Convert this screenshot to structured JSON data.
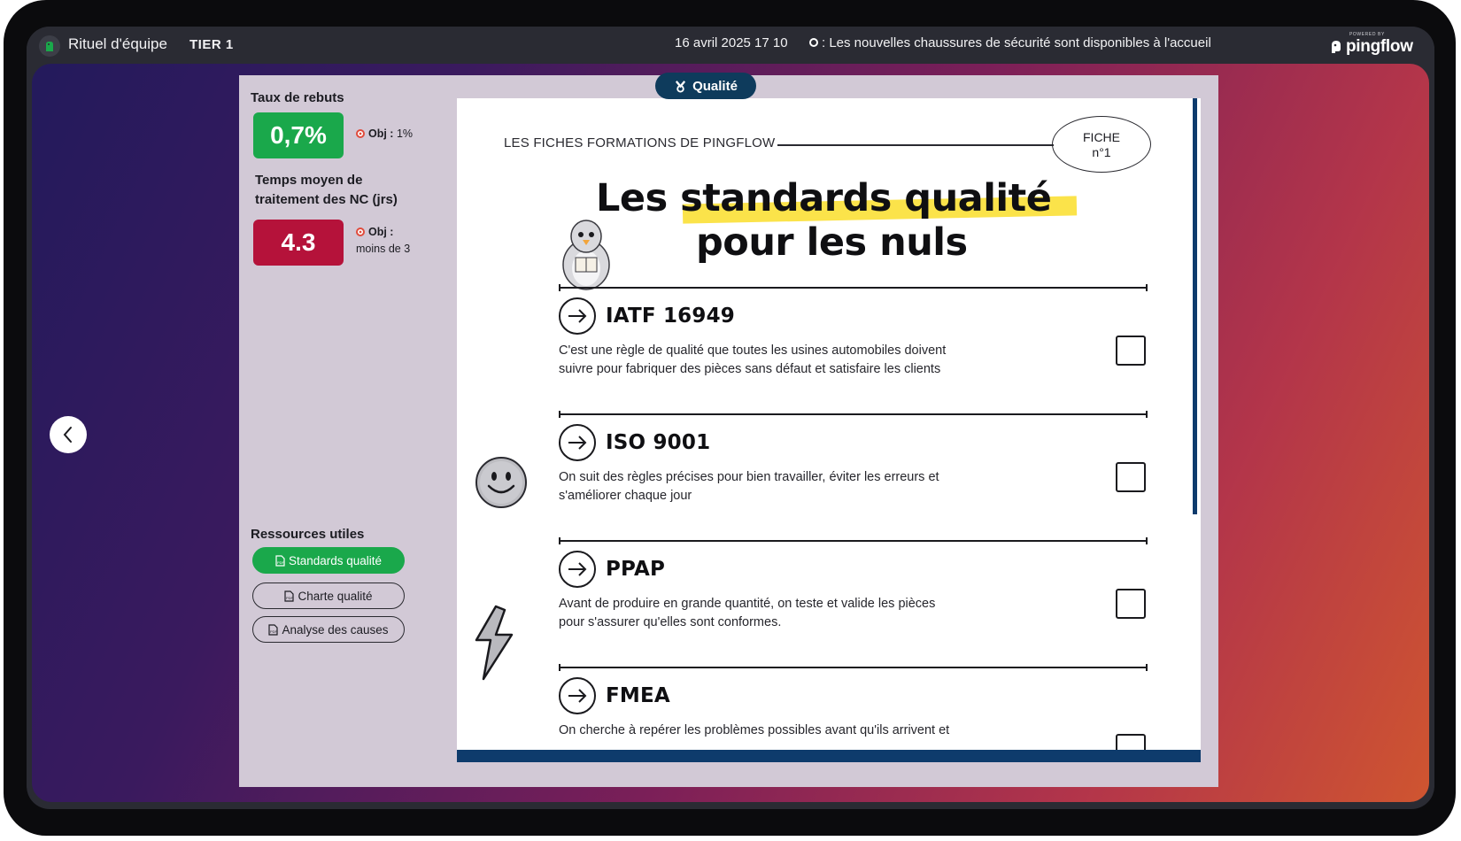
{
  "header": {
    "app_title": "Rituel d'équipe",
    "tier": "TIER 1",
    "datetime": "16 avril 2025 17 10",
    "ticker": ": Les nouvelles chaussures de sécurité sont disponibles à l'accueil",
    "brand_powered": "POWERED BY",
    "brand_name": "pingflow"
  },
  "card": {
    "tab_label": "Qualité",
    "kpis": [
      {
        "label": "Taux de rebuts",
        "value": "0,7%",
        "value_color": "#1aa84b",
        "obj_label": "Obj :",
        "obj_value": "1%"
      },
      {
        "label_line1": "Temps moyen de",
        "label_line2": "traitement des NC (jrs)",
        "value": "4.3",
        "value_color": "#b5123a",
        "obj_label": "Obj :",
        "obj_value": "moins de 3"
      }
    ],
    "resources": {
      "title": "Ressources utiles",
      "items": [
        {
          "label": "Standards qualité",
          "active": true
        },
        {
          "label": "Charte qualité",
          "active": false
        },
        {
          "label": "Analyse des causes",
          "active": false
        }
      ]
    }
  },
  "document": {
    "series_label": "LES FICHES FORMATIONS DE PINGFLOW",
    "fiche_line1": "FICHE",
    "fiche_line2": "n°1",
    "title_part1": "Les",
    "title_highlight": "standards qualité",
    "title_line2": "pour les nuls",
    "standards": [
      {
        "name": "IATF 16949",
        "desc_line1": "C'est une règle de qualité que toutes les usines automobiles doivent",
        "desc_line2": "suivre pour fabriquer des pièces sans défaut et satisfaire les clients",
        "checked": false
      },
      {
        "name": "ISO 9001",
        "desc_line1": "On suit des règles précises pour bien travailler, éviter les erreurs et",
        "desc_line2": "s'améliorer chaque jour",
        "checked": false
      },
      {
        "name": "PPAP",
        "desc_line1": "Avant de produire en grande quantité, on teste et valide les pièces",
        "desc_line2": "pour s'assurer qu'elles sont conformes.",
        "checked": false
      },
      {
        "name": "FMEA",
        "desc_line1": "On cherche à repérer les problèmes possibles avant qu'ils arrivent et",
        "desc_line2": "",
        "checked": false
      }
    ]
  },
  "colors": {
    "accent_green": "#1aa84b",
    "alert_red": "#b5123a",
    "navy": "#0e3b5c",
    "highlight_yellow": "#fbe34a"
  },
  "icons": [
    "app-logo-icon",
    "pingflow-logo-icon",
    "chevron-left-icon",
    "qualite-tab-icon",
    "target-icon",
    "pdf-icon",
    "arrow-right-icon",
    "checkbox-icon",
    "mascot-illustration",
    "smiley-icon",
    "lightning-icon"
  ]
}
